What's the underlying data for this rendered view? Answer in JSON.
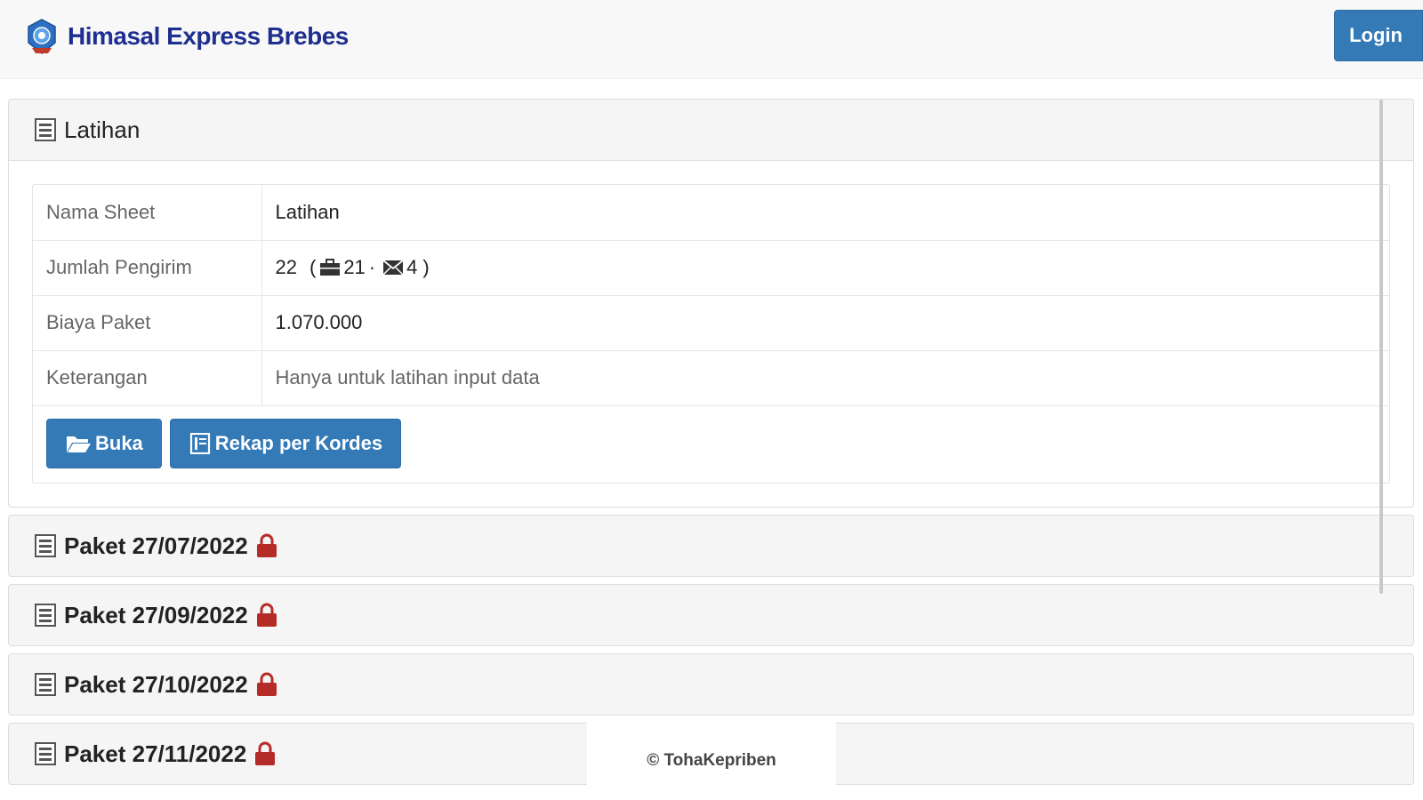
{
  "header": {
    "brand_text": "Himasal Express Brebes",
    "login_label": "Login",
    "accent_color": "#337ab7",
    "brand_color": "#1f2f8f"
  },
  "active_panel": {
    "title": "Latihan",
    "rows": [
      {
        "label": "Nama Sheet",
        "value": "Latihan"
      },
      {
        "label": "Jumlah Pengirim",
        "total": "22",
        "paren_open": "(",
        "count_a": "21",
        "separator": "·",
        "count_b": "4",
        "paren_close": ")"
      },
      {
        "label": "Biaya Paket",
        "value": "1.070.000"
      },
      {
        "label": "Keterangan",
        "value": "Hanya untuk latihan input data"
      }
    ],
    "buttons": {
      "open_label": "Buka",
      "recap_label": "Rekap per Kordes"
    }
  },
  "locked_panels": [
    {
      "title": "Paket 27/07/2022"
    },
    {
      "title": "Paket 27/09/2022"
    },
    {
      "title": "Paket 27/10/2022"
    },
    {
      "title": "Paket 27/11/2022"
    }
  ],
  "icons": {
    "sheet": "sheet-icon",
    "lock": "lock-icon",
    "briefcase": "briefcase-icon",
    "envelope": "envelope-icon",
    "folder": "folder-open-icon",
    "book": "book-icon",
    "lock_color": "#b52b27"
  },
  "footer": {
    "text": "© TohaKepriben"
  }
}
